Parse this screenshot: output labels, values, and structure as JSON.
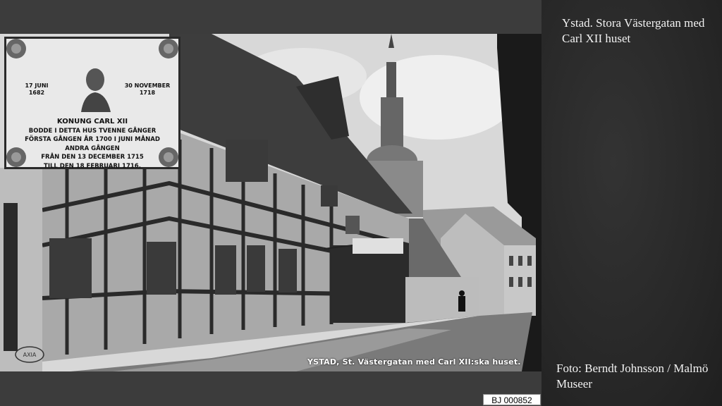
{
  "slide": {
    "caption_top": "Ystad. Stora Västergatan med Carl XII huset",
    "caption_bottom": "Foto: Berndt Johnsson / Malmö Museer",
    "id_label": "BJ 000852"
  },
  "photo": {
    "caption": "YSTAD, St. Västergatan med Carl XII:ska huset.",
    "shop_sign": "",
    "stamp": "AXIA",
    "plaque": {
      "date_left": [
        "17 JUNI",
        "1682"
      ],
      "date_right": [
        "30 NOVEMBER",
        "1718"
      ],
      "lines": [
        "KONUNG CARL XII",
        "BODDE I DETTA HUS TVENNE GÅNGER",
        "FÖRSTA GÅNGEN ÅR 1700 I JUNI MÅNAD",
        "ANDRA GÅNGEN",
        "FRÅN DEN 13 DECEMBER 1715",
        "TILL DEN 18 FEBRUARI 1716."
      ]
    }
  },
  "colors": {
    "background": "#3c3c3c",
    "panel": "#262626",
    "caption_text": "#f2f2f2"
  }
}
